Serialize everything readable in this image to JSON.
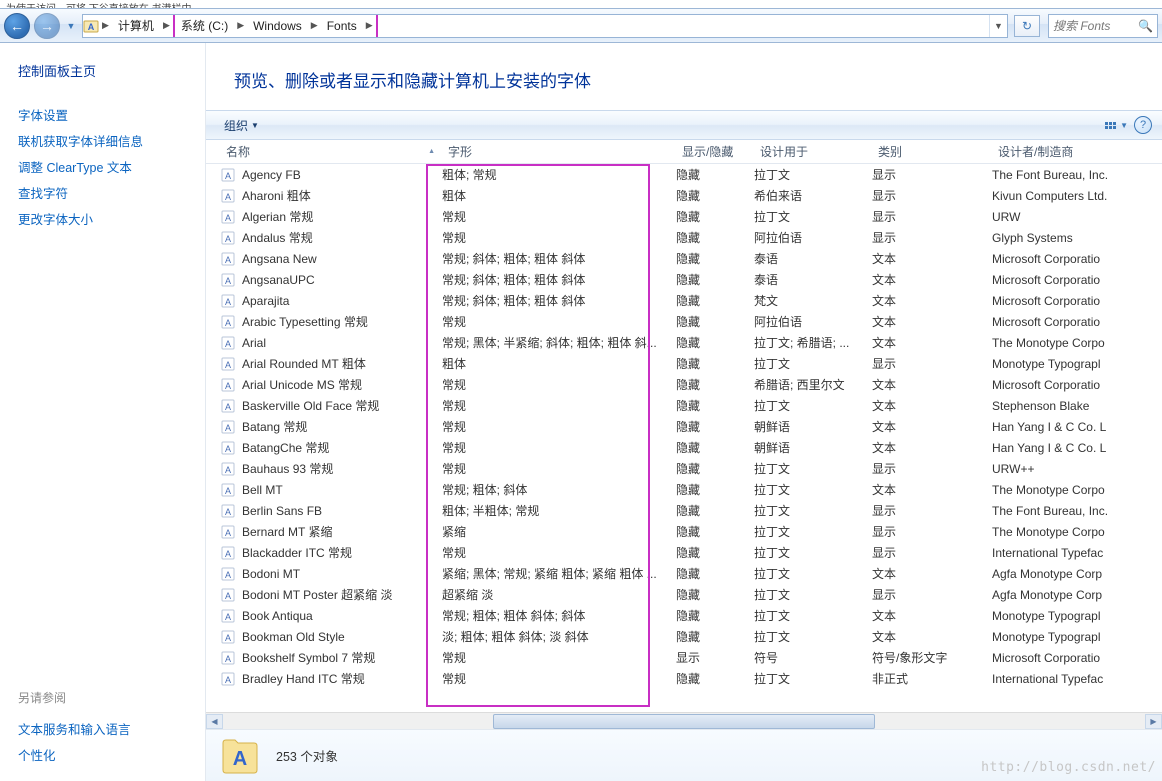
{
  "top_crop_text": "为使于访问，可将 下谷直接放在 书港栏中。",
  "nav": {
    "back_glyph": "←",
    "forward_glyph": "→",
    "computer_label": "计算机",
    "search_placeholder": "搜索 Fonts",
    "refresh_glyph": "↻",
    "breadcrumb": [
      {
        "label": "系统 (C:)"
      },
      {
        "label": "Windows"
      },
      {
        "label": "Fonts"
      }
    ]
  },
  "sidebar": {
    "home": "控制面板主页",
    "links": [
      "字体设置",
      "联机获取字体详细信息",
      "调整 ClearType 文本",
      "查找字符",
      "更改字体大小"
    ],
    "also_label": "另请参阅",
    "also_links": [
      "文本服务和输入语言",
      "个性化"
    ]
  },
  "heading": "预览、删除或者显示和隐藏计算机上安装的字体",
  "toolbar": {
    "organize": "组织"
  },
  "columns": {
    "name": "名称",
    "style": "字形",
    "hide": "显示/隐藏",
    "design": "设计用于",
    "category": "类别",
    "maker": "设计者/制造商"
  },
  "rows": [
    {
      "name": "Agency FB",
      "style": "粗体; 常规",
      "hide": "隐藏",
      "design": "拉丁文",
      "cat": "显示",
      "maker": "The Font Bureau, Inc."
    },
    {
      "name": "Aharoni 粗体",
      "style": "粗体",
      "hide": "隐藏",
      "design": "希伯来语",
      "cat": "显示",
      "maker": "Kivun Computers Ltd."
    },
    {
      "name": "Algerian 常规",
      "style": "常规",
      "hide": "隐藏",
      "design": "拉丁文",
      "cat": "显示",
      "maker": "URW"
    },
    {
      "name": "Andalus 常规",
      "style": "常规",
      "hide": "隐藏",
      "design": "阿拉伯语",
      "cat": "显示",
      "maker": "Glyph Systems"
    },
    {
      "name": "Angsana New",
      "style": "常规; 斜体; 粗体; 粗体 斜体",
      "hide": "隐藏",
      "design": "泰语",
      "cat": "文本",
      "maker": "Microsoft Corporatio"
    },
    {
      "name": "AngsanaUPC",
      "style": "常规; 斜体; 粗体; 粗体 斜体",
      "hide": "隐藏",
      "design": "泰语",
      "cat": "文本",
      "maker": "Microsoft Corporatio"
    },
    {
      "name": "Aparajita",
      "style": "常规; 斜体; 粗体; 粗体 斜体",
      "hide": "隐藏",
      "design": "梵文",
      "cat": "文本",
      "maker": "Microsoft Corporatio"
    },
    {
      "name": "Arabic Typesetting 常规",
      "style": "常规",
      "hide": "隐藏",
      "design": "阿拉伯语",
      "cat": "文本",
      "maker": "Microsoft Corporatio"
    },
    {
      "name": "Arial",
      "style": "常规; 黑体; 半紧缩; 斜体; 粗体; 粗体 斜...",
      "hide": "隐藏",
      "design": "拉丁文; 希腊语; ...",
      "cat": "文本",
      "maker": "The Monotype Corpo"
    },
    {
      "name": "Arial Rounded MT 粗体",
      "style": "粗体",
      "hide": "隐藏",
      "design": "拉丁文",
      "cat": "显示",
      "maker": "Monotype Typograpl"
    },
    {
      "name": "Arial Unicode MS 常规",
      "style": "常规",
      "hide": "隐藏",
      "design": "希腊语; 西里尔文",
      "cat": "文本",
      "maker": "Microsoft Corporatio"
    },
    {
      "name": "Baskerville Old Face 常规",
      "style": "常规",
      "hide": "隐藏",
      "design": "拉丁文",
      "cat": "文本",
      "maker": "Stephenson Blake"
    },
    {
      "name": "Batang 常规",
      "style": "常规",
      "hide": "隐藏",
      "design": "朝鲜语",
      "cat": "文本",
      "maker": "Han Yang I & C Co. L"
    },
    {
      "name": "BatangChe 常规",
      "style": "常规",
      "hide": "隐藏",
      "design": "朝鲜语",
      "cat": "文本",
      "maker": "Han Yang I & C Co. L"
    },
    {
      "name": "Bauhaus 93 常规",
      "style": "常规",
      "hide": "隐藏",
      "design": "拉丁文",
      "cat": "显示",
      "maker": "URW++"
    },
    {
      "name": "Bell MT",
      "style": "常规; 粗体; 斜体",
      "hide": "隐藏",
      "design": "拉丁文",
      "cat": "文本",
      "maker": "The Monotype Corpo"
    },
    {
      "name": "Berlin Sans FB",
      "style": "粗体; 半粗体; 常规",
      "hide": "隐藏",
      "design": "拉丁文",
      "cat": "显示",
      "maker": "The Font Bureau, Inc."
    },
    {
      "name": "Bernard MT 紧缩",
      "style": "紧缩",
      "hide": "隐藏",
      "design": "拉丁文",
      "cat": "显示",
      "maker": "The Monotype Corpo"
    },
    {
      "name": "Blackadder ITC 常规",
      "style": "常规",
      "hide": "隐藏",
      "design": "拉丁文",
      "cat": "显示",
      "maker": "International Typefac"
    },
    {
      "name": "Bodoni MT",
      "style": "紧缩; 黑体; 常规; 紧缩 粗体; 紧缩 粗体 ...",
      "hide": "隐藏",
      "design": "拉丁文",
      "cat": "文本",
      "maker": "Agfa Monotype Corp"
    },
    {
      "name": "Bodoni MT Poster 超紧缩 淡",
      "style": "超紧缩 淡",
      "hide": "隐藏",
      "design": "拉丁文",
      "cat": "显示",
      "maker": "Agfa Monotype Corp"
    },
    {
      "name": "Book Antiqua",
      "style": "常规; 粗体; 粗体 斜体; 斜体",
      "hide": "隐藏",
      "design": "拉丁文",
      "cat": "文本",
      "maker": "Monotype Typograpl"
    },
    {
      "name": "Bookman Old Style",
      "style": "淡; 粗体; 粗体 斜体; 淡 斜体",
      "hide": "隐藏",
      "design": "拉丁文",
      "cat": "文本",
      "maker": "Monotype Typograpl"
    },
    {
      "name": "Bookshelf Symbol 7 常规",
      "style": "常规",
      "hide": "显示",
      "design": "符号",
      "cat": "符号/象形文字",
      "maker": "Microsoft Corporatio"
    },
    {
      "name": "Bradley Hand ITC 常规",
      "style": "常规",
      "hide": "隐藏",
      "design": "拉丁文",
      "cat": "非正式",
      "maker": "International Typefac"
    }
  ],
  "status": {
    "count_label": "253 个对象"
  },
  "watermark": "http://blog.csdn.net/"
}
